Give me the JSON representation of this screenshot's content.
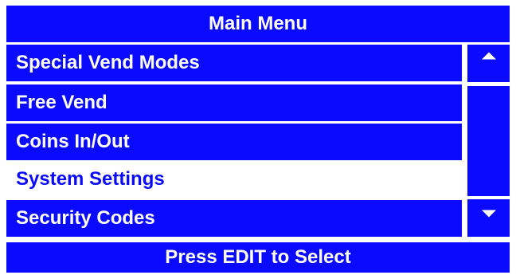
{
  "header": {
    "title": "Main Menu"
  },
  "menu": {
    "items": [
      {
        "label": "Special Vend Modes",
        "selected": false
      },
      {
        "label": "Free Vend",
        "selected": false
      },
      {
        "label": "Coins In/Out",
        "selected": false
      },
      {
        "label": "System Settings",
        "selected": true
      },
      {
        "label": "Security Codes",
        "selected": false
      }
    ]
  },
  "scrollbar": {
    "up_icon": "triangle-up-icon",
    "down_icon": "triangle-down-icon"
  },
  "footer": {
    "prompt": "Press EDIT to Select"
  },
  "colors": {
    "primary": "#0a0aff",
    "text_on_primary": "#ffffff",
    "background": "#ffffff"
  }
}
